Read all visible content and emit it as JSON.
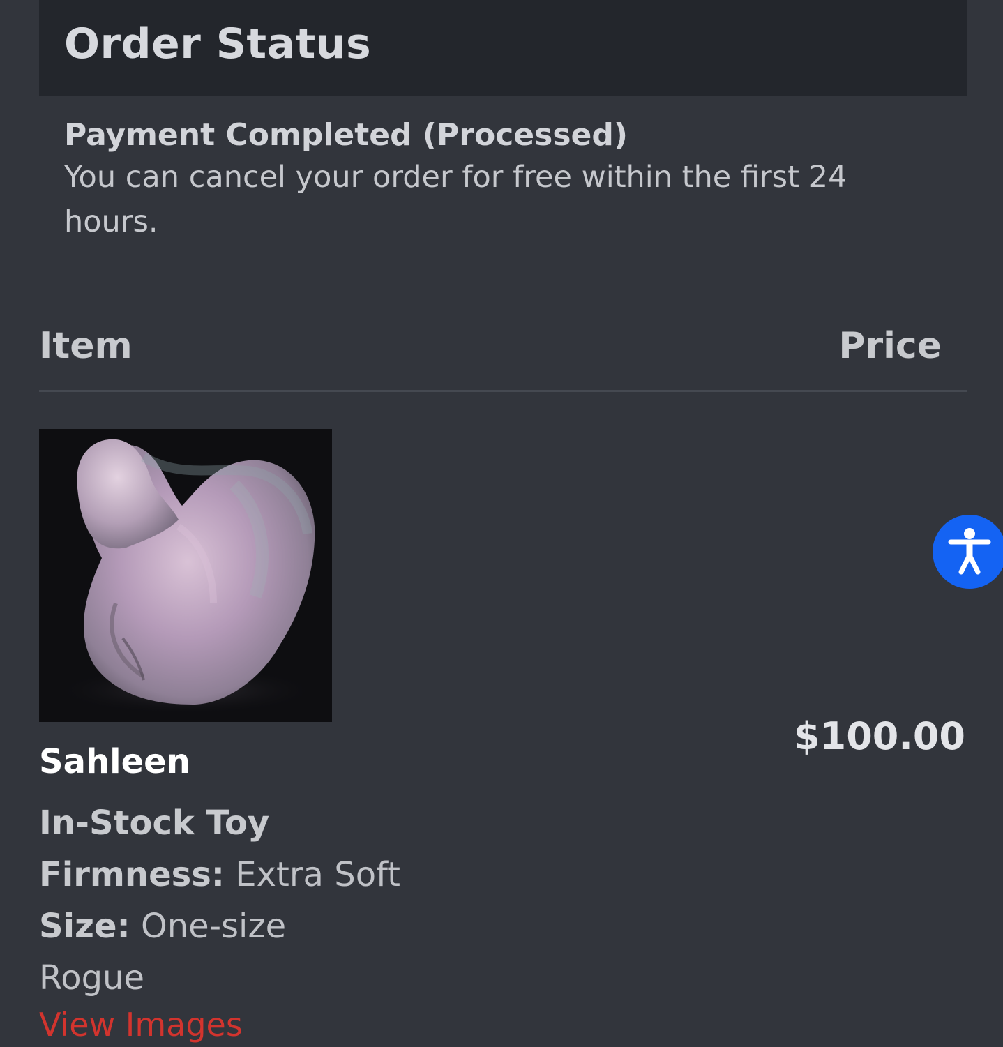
{
  "header": {
    "title": "Order Status"
  },
  "status": {
    "label": "Payment Completed (Processed)",
    "note": "You can cancel your order for free within the first 24 hours."
  },
  "table": {
    "col_item": "Item",
    "col_price": "Price"
  },
  "order_item": {
    "name": "Sahleen",
    "price": "$100.00",
    "type": "In-Stock Toy",
    "firmness_label": "Firmness:",
    "firmness_value": " Extra Soft",
    "size_label": "Size:",
    "size_value": " One-size",
    "variant": "Rogue",
    "view_images": "View Images"
  },
  "accessibility": {
    "icon": "accessibility-icon",
    "color": "#1463f3"
  },
  "colors": {
    "link": "#d2342e",
    "background": "#32353c",
    "header_bg": "#23262c"
  }
}
